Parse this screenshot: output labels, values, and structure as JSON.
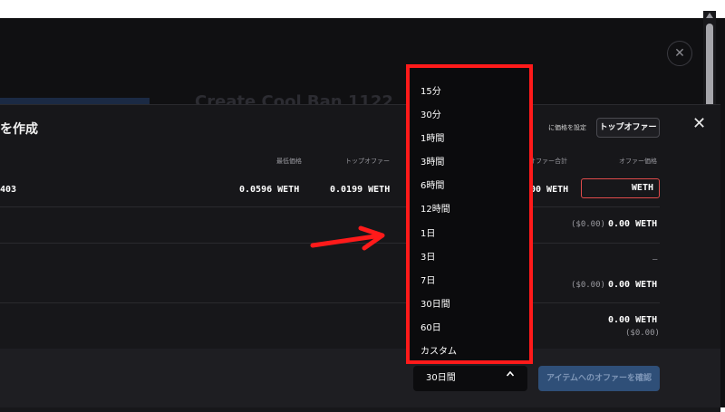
{
  "modal": {
    "title": "を作成",
    "set_price_label": "に価格を設定",
    "top_offer_button": "トップオファー",
    "close": "✕"
  },
  "outer_close": "✕",
  "background": {
    "ghost_text": "Create Cool Ban 1122"
  },
  "table": {
    "headers": {
      "floor_price": "最低価格",
      "top_offer": "トップオファー",
      "offer_total": "オファー合計",
      "offer_price": "オファー価格"
    },
    "row": {
      "name_suffix": "403",
      "floor_price": "0.0596 WETH",
      "top_offer": "0.0199 WETH",
      "offer_total_partial": "00 WETH",
      "offer_input_value": "WETH"
    }
  },
  "summary": [
    {
      "usd": "($0.00)",
      "amount": "0.00 WETH"
    },
    {
      "dash": "–"
    },
    {
      "usd": "($0.00)",
      "amount": "0.00 WETH"
    },
    {
      "amount": "0.00 WETH",
      "usd": "($0.00)"
    }
  ],
  "footer": {
    "duration_selected": "30日間",
    "confirm_button": "アイテムへのオファーを確認"
  },
  "duration_options": [
    "15分",
    "30分",
    "1時間",
    "3時間",
    "6時間",
    "12時間",
    "1日",
    "3日",
    "7日",
    "30日間",
    "60日",
    "カスタム"
  ],
  "colors": {
    "highlight": "#ff1a1a",
    "annotation_arrow": "#ff1a1a",
    "confirm_button_bg": "#2f4f78",
    "offer_input_border": "#e04b4b"
  }
}
